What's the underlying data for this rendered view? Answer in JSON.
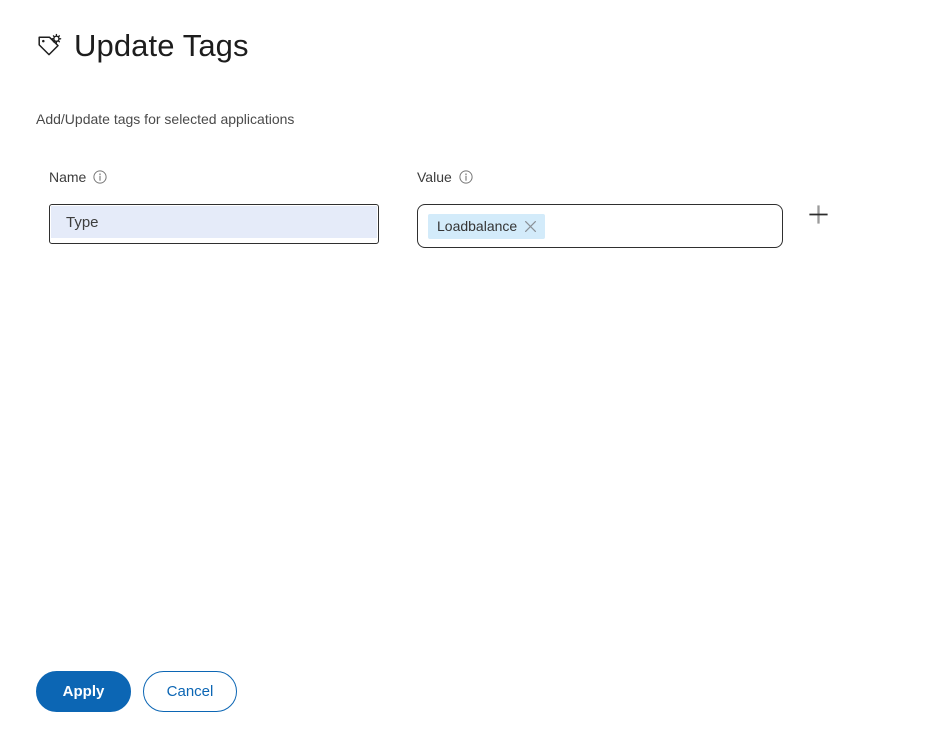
{
  "header": {
    "icon": "tag-sparkle-icon",
    "title": "Update Tags"
  },
  "subtitle": "Add/Update tags for selected applications",
  "form": {
    "rows": [
      {
        "name_label": "Name",
        "name_info_icon": "info-circle-icon",
        "name_value": "Type",
        "value_label": "Value",
        "value_info_icon": "info-circle-icon",
        "chips": [
          {
            "label": "Loadbalance",
            "remove_icon": "close-x-icon"
          }
        ],
        "add_icon": "plus-icon"
      }
    ]
  },
  "footer": {
    "apply_label": "Apply",
    "cancel_label": "Cancel"
  },
  "colors": {
    "accent_blue": "#0c66b4",
    "chip_background": "#d3ebfa",
    "suggestion_highlight": "#e5ebf9",
    "border_dark": "#2f2f2f",
    "page_background": "#ffffff"
  }
}
